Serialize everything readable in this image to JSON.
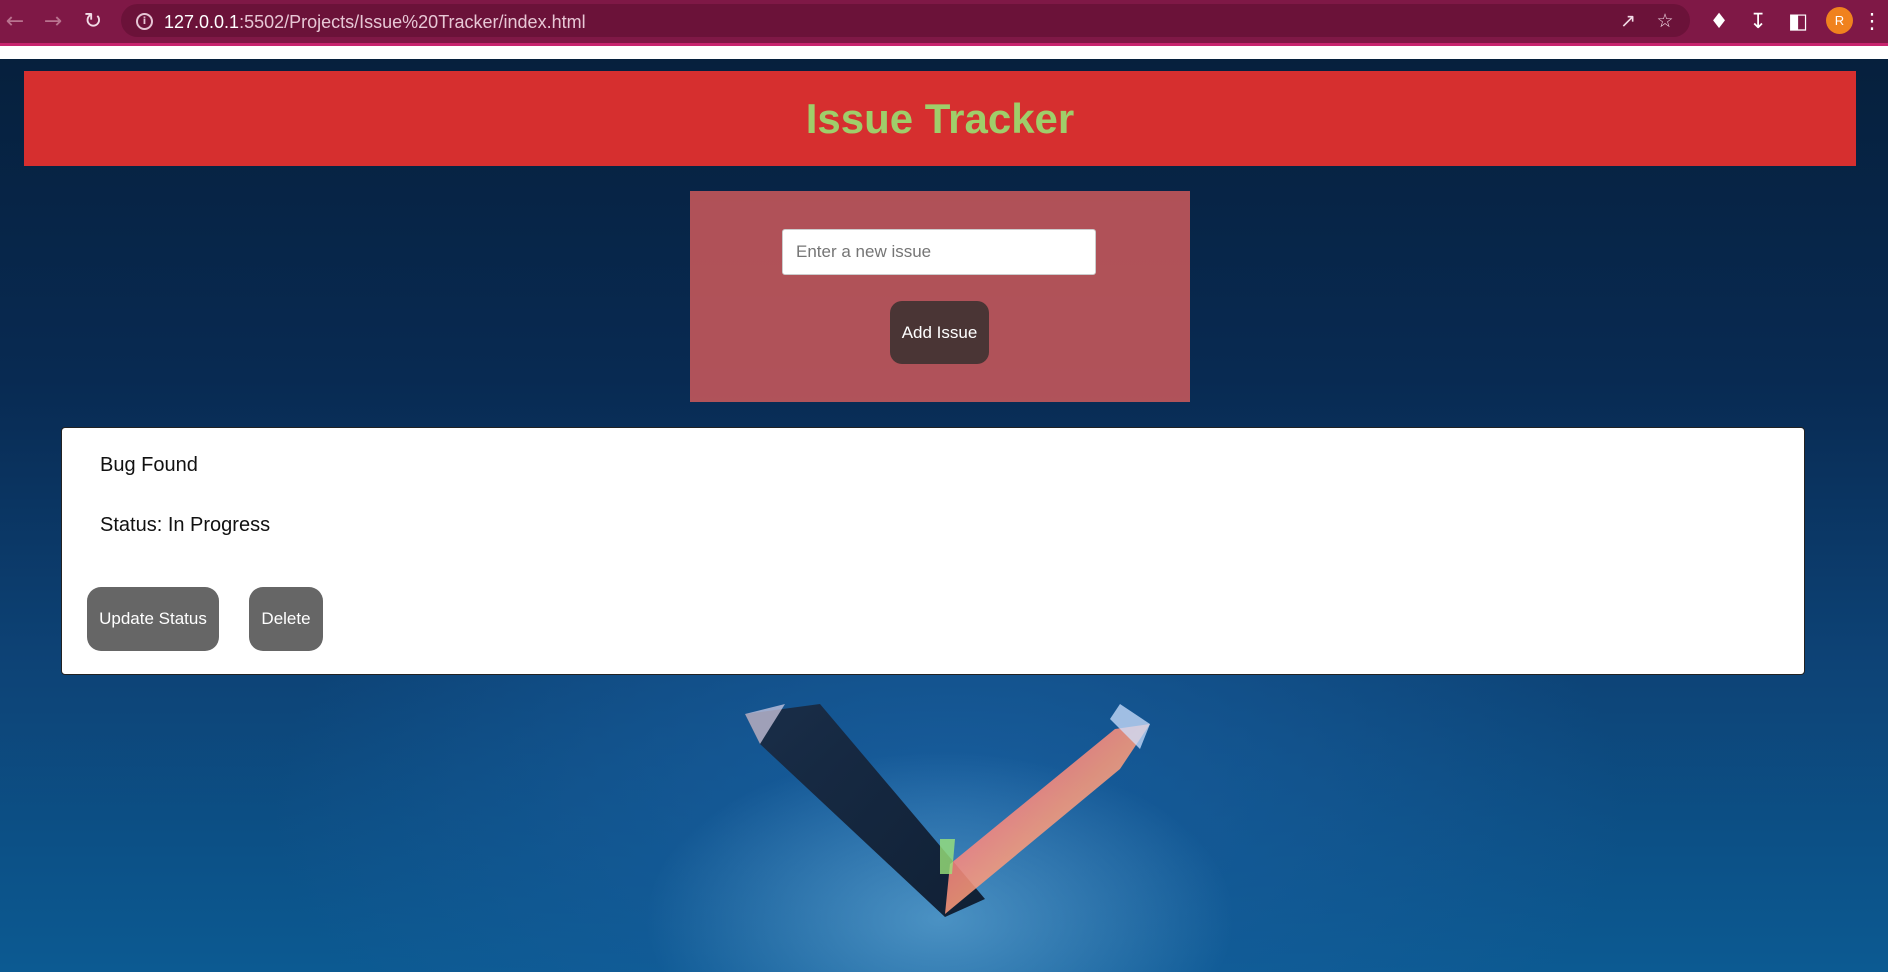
{
  "browser": {
    "url_host": "127.0.0.1",
    "url_rest": ":5502/Projects/Issue%20Tracker/index.html",
    "avatar_initial": "R",
    "icons": [
      "back-arrow-icon",
      "forward-arrow-icon",
      "reload-icon",
      "info-icon",
      "share-icon",
      "star-icon",
      "extensions-icon",
      "download-icon",
      "side-panel-icon",
      "menu-dots-icon"
    ]
  },
  "header": {
    "title": "Issue Tracker"
  },
  "form": {
    "input_placeholder": "Enter a new issue",
    "input_value": "",
    "add_button_label": "Add Issue"
  },
  "issues": [
    {
      "title": "Bug Found",
      "status": "Status: In Progress",
      "update_label": "Update Status",
      "delete_label": "Delete"
    }
  ],
  "colors": {
    "browser_bar": "#7f1846",
    "header_bg": "#d62f2f",
    "header_text": "#9fce6a",
    "form_bg": "#d65c5c",
    "add_button": "#4a3535",
    "card_button": "#666666"
  }
}
